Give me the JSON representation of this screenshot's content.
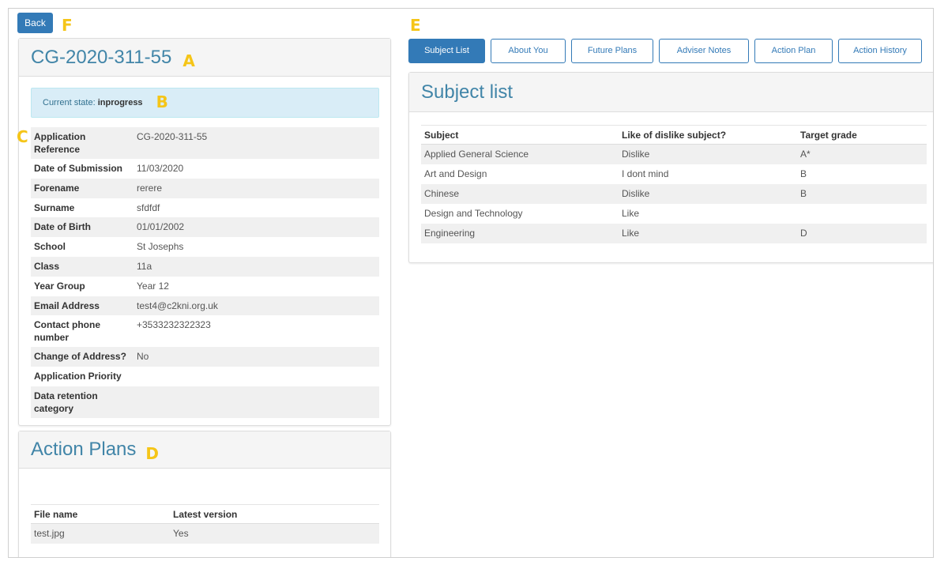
{
  "back_button": "Back",
  "markers": {
    "a": "A",
    "b": "B",
    "c": "C",
    "d": "D",
    "e": "E",
    "f": "F"
  },
  "application": {
    "title": "CG-2020-311-55",
    "state_label": "Current state:",
    "state_value": "inprogress",
    "details": [
      {
        "label": "Application Reference",
        "value": "CG-2020-311-55"
      },
      {
        "label": "Date of Submission",
        "value": "11/03/2020"
      },
      {
        "label": "Forename",
        "value": "rerere"
      },
      {
        "label": "Surname",
        "value": "sfdfdf"
      },
      {
        "label": "Date of Birth",
        "value": "01/01/2002"
      },
      {
        "label": "School",
        "value": "St Josephs"
      },
      {
        "label": "Class",
        "value": "11a"
      },
      {
        "label": "Year Group",
        "value": "Year 12"
      },
      {
        "label": "Email Address",
        "value": "test4@c2kni.org.uk"
      },
      {
        "label": "Contact phone number",
        "value": "+3533232322323"
      },
      {
        "label": "Change of Address?",
        "value": "No"
      },
      {
        "label": "Application Priority",
        "value": ""
      },
      {
        "label": "Data retention category",
        "value": ""
      }
    ]
  },
  "action_plans": {
    "title": "Action Plans",
    "columns": [
      "File name",
      "Latest version"
    ],
    "rows": [
      {
        "file": "test.jpg",
        "latest": "Yes"
      }
    ]
  },
  "tabs": [
    {
      "label": "Subject List",
      "active": true
    },
    {
      "label": "About You",
      "active": false
    },
    {
      "label": "Future Plans",
      "active": false
    },
    {
      "label": "Adviser Notes",
      "active": false
    },
    {
      "label": "Action Plan",
      "active": false
    },
    {
      "label": "Action History",
      "active": false
    }
  ],
  "subject_list": {
    "title": "Subject list",
    "columns": [
      "Subject",
      "Like of dislike subject?",
      "Target grade"
    ],
    "rows": [
      {
        "subject": "Applied General Science",
        "like": "Dislike",
        "grade": "A*"
      },
      {
        "subject": "Art and Design",
        "like": "I dont mind",
        "grade": "B"
      },
      {
        "subject": "Chinese",
        "like": "Dislike",
        "grade": "B"
      },
      {
        "subject": "Design and Technology",
        "like": "Like",
        "grade": ""
      },
      {
        "subject": "Engineering",
        "like": "Like",
        "grade": "D"
      }
    ]
  },
  "colors": {
    "primary": "#337ab7",
    "heading": "#4185a8",
    "marker": "#f5c518",
    "info_bg": "#d9edf7"
  }
}
